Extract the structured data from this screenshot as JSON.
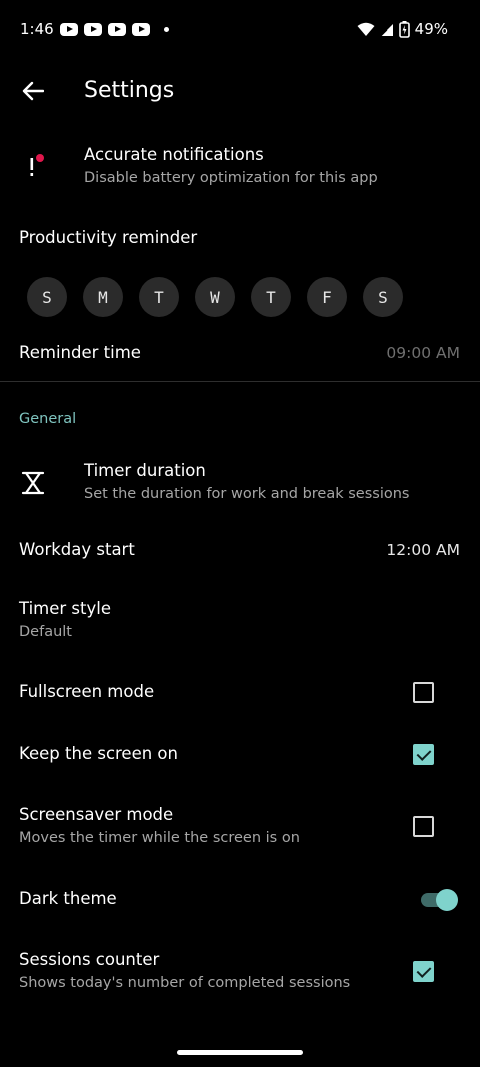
{
  "status_bar": {
    "time": "1:46",
    "battery": "49%",
    "icons": [
      "youtube-icon",
      "youtube-icon",
      "youtube-icon",
      "youtube-icon",
      "dot-icon",
      "wifi-icon",
      "signal-icon",
      "battery-icon"
    ]
  },
  "app_bar": {
    "title": "Settings",
    "back_icon": "arrow-back-icon"
  },
  "accurate_notifications": {
    "title": "Accurate notifications",
    "subtitle": "Disable battery optimization for this app",
    "icon": "exclamation-alert-icon",
    "accent_color": "#e0174c"
  },
  "productivity_reminder": {
    "title": "Productivity reminder",
    "days": [
      "S",
      "M",
      "T",
      "W",
      "T",
      "F",
      "S"
    ]
  },
  "reminder_time": {
    "title": "Reminder time",
    "value": "09:00 AM"
  },
  "section_general": "General",
  "timer_duration": {
    "title": "Timer duration",
    "subtitle": "Set the duration for work and break sessions",
    "icon": "hourglass-icon"
  },
  "workday_start": {
    "title": "Workday start",
    "value": "12:00 AM"
  },
  "timer_style": {
    "title": "Timer style",
    "subtitle": "Default"
  },
  "fullscreen_mode": {
    "title": "Fullscreen mode",
    "checked": false
  },
  "keep_screen_on": {
    "title": "Keep the screen on",
    "checked": true
  },
  "screensaver_mode": {
    "title": "Screensaver mode",
    "subtitle": "Moves the timer while the screen is on",
    "checked": false
  },
  "dark_theme": {
    "title": "Dark theme",
    "on": true
  },
  "sessions_counter": {
    "title": "Sessions counter",
    "subtitle": "Shows today's number of completed sessions",
    "checked": true
  },
  "colors": {
    "background": "#000000",
    "accent": "#7fd3cc",
    "section_header": "#7fc4bf",
    "secondary_text": "#a6a6a6",
    "muted_value": "#6f6f6f",
    "chip_bg": "#2b2b2b"
  }
}
